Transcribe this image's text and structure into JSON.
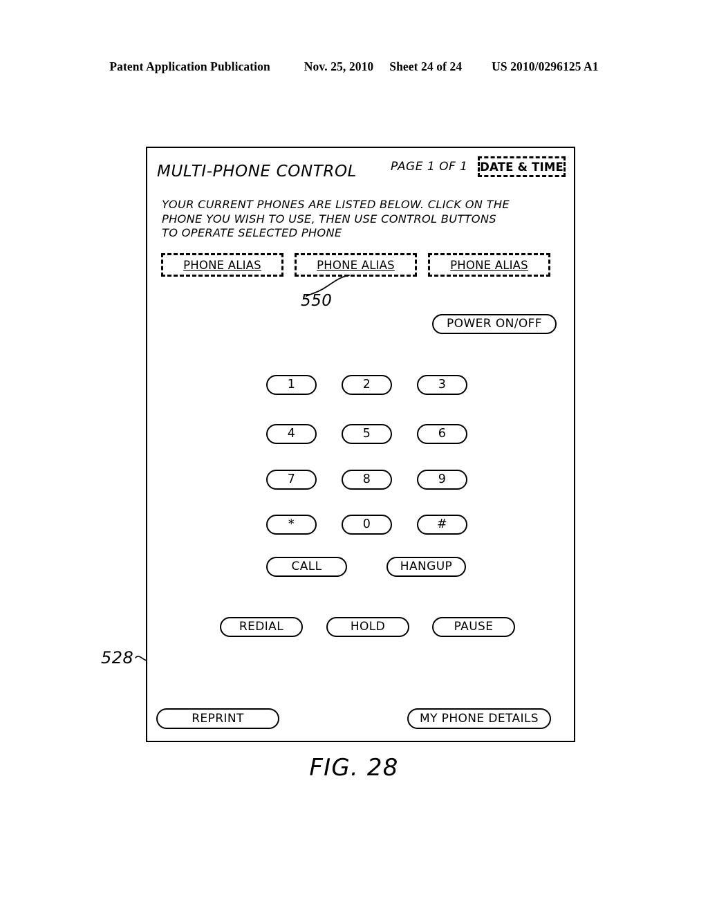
{
  "patent_header": {
    "publication": "Patent Application Publication",
    "date": "Nov. 25, 2010",
    "sheet": "Sheet 24 of 24",
    "number": "US 2010/0296125 A1"
  },
  "figure": {
    "caption": "FIG. 28",
    "reference_numerals": {
      "screen": "528",
      "phone_alias_group": "550"
    }
  },
  "screen": {
    "title": "MULTI-PHONE CONTROL",
    "page_indicator": "PAGE 1 OF 1",
    "date_time_label": "DATE & TIME",
    "instructions": {
      "line1": "YOUR CURRENT PHONES ARE LISTED BELOW. CLICK ON THE",
      "line2": "PHONE YOU WISH TO USE, THEN USE CONTROL BUTTONS",
      "line3": "TO OPERATE SELECTED PHONE"
    },
    "phone_aliases": [
      {
        "label": "PHONE ALIAS"
      },
      {
        "label": "PHONE ALIAS"
      },
      {
        "label": "PHONE ALIAS"
      }
    ],
    "power_button": "POWER ON/OFF",
    "keypad": [
      {
        "label": "1"
      },
      {
        "label": "2"
      },
      {
        "label": "3"
      },
      {
        "label": "4"
      },
      {
        "label": "5"
      },
      {
        "label": "6"
      },
      {
        "label": "7"
      },
      {
        "label": "8"
      },
      {
        "label": "9"
      },
      {
        "label": "*"
      },
      {
        "label": "0"
      },
      {
        "label": "#"
      }
    ],
    "call_controls": {
      "call": "CALL",
      "hangup": "HANGUP"
    },
    "secondary_controls": {
      "redial": "REDIAL",
      "hold": "HOLD",
      "pause": "PAUSE"
    },
    "bottom_controls": {
      "reprint": "REPRINT",
      "my_phone_details": "MY PHONE DETAILS"
    }
  },
  "colors": {
    "ink": "#000000",
    "paper": "#ffffff"
  }
}
